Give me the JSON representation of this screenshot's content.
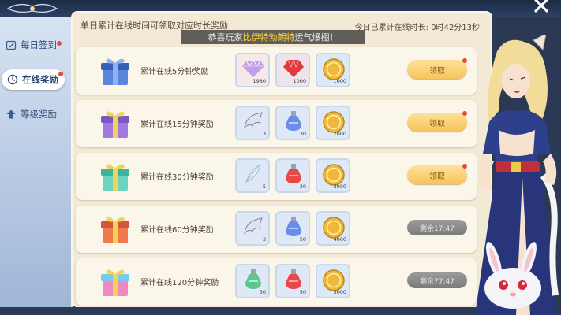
{
  "header": {
    "hint": "单日累计在线时间可领取对应时长奖励",
    "today_online_label": "今日已累计在线时长:",
    "today_online_value": "0时42分13秒",
    "marquee_prefix": "恭喜玩家",
    "marquee_player": "比伊特勃朗特",
    "marquee_suffix": "运气爆棚！"
  },
  "sidebar": {
    "items": [
      {
        "label": "每日签到",
        "icon": "calendar-check-icon",
        "badge": true
      },
      {
        "label": "在线奖励",
        "icon": "clock-icon",
        "badge": true,
        "active": true
      },
      {
        "label": "等级奖励",
        "icon": "level-up-icon",
        "badge": false
      }
    ]
  },
  "rewards": [
    {
      "label": "累计在线5分钟奖励",
      "gift": "blue",
      "items": [
        {
          "name": "rainbow-gem",
          "qty": "1980"
        },
        {
          "name": "red-gem",
          "qty": "1000"
        },
        {
          "name": "gold-coin",
          "qty": "1000"
        }
      ],
      "status": "claim",
      "button": "领取"
    },
    {
      "label": "累计在线15分钟奖励",
      "gift": "purple",
      "items": [
        {
          "name": "wing",
          "qty": "3"
        },
        {
          "name": "blue-potion",
          "qty": "30"
        },
        {
          "name": "gold-coin",
          "qty": "2000"
        }
      ],
      "status": "claim",
      "button": "领取"
    },
    {
      "label": "累计在线30分钟奖励",
      "gift": "teal",
      "items": [
        {
          "name": "feather",
          "qty": "5"
        },
        {
          "name": "red-potion",
          "qty": "30"
        },
        {
          "name": "gold-coin",
          "qty": "3000"
        }
      ],
      "status": "claim",
      "button": "领取"
    },
    {
      "label": "累计在线60分钟奖励",
      "gift": "red",
      "items": [
        {
          "name": "wing",
          "qty": "3"
        },
        {
          "name": "blue-potion",
          "qty": "50"
        },
        {
          "name": "gold-coin",
          "qty": "4000"
        }
      ],
      "status": "wait",
      "button": "剩余17:47"
    },
    {
      "label": "累计在线120分钟奖励",
      "gift": "rainbow",
      "items": [
        {
          "name": "green-potion",
          "qty": "30"
        },
        {
          "name": "red-potion",
          "qty": "50"
        },
        {
          "name": "gold-coin",
          "qty": "5000"
        }
      ],
      "status": "wait",
      "button": "剩余77:47"
    }
  ],
  "colors": {
    "panel": "#f3ead6",
    "row": "#fbf6ea",
    "claim": "#f6c45a",
    "wait": "#8a8a8a",
    "badge": "#e94a3a",
    "highlight": "#ffd53a"
  }
}
